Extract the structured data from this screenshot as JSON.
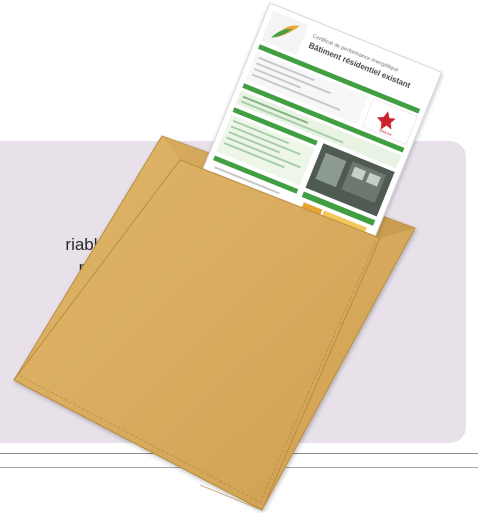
{
  "panel": {
    "line1": "riable",
    "line2": "met"
  },
  "certificate": {
    "title": "Bâtiment résidentiel existant",
    "logo_label": "Wallonie"
  },
  "colors": {
    "panel_background": "#e8e1ea",
    "envelope": "#d8ac61",
    "certificate_green": "#3f9f3f",
    "certificate_band": "#e8f3e3",
    "logo_red": "#c8232b"
  }
}
